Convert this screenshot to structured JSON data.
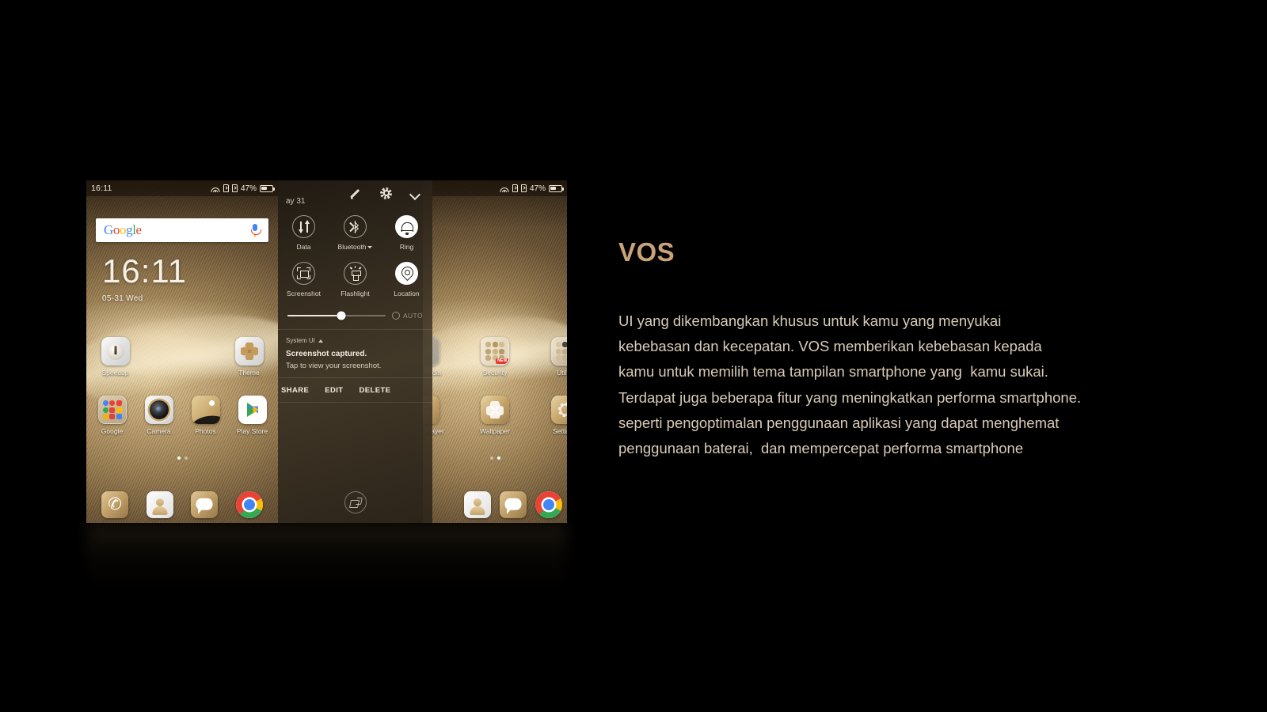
{
  "marketing": {
    "headline": "VOS",
    "body": "UI yang dikembangkan khusus untuk kamu yang menyukai\nkebebasan dan kecepatan. VOS memberikan kebebasan kepada\nkamu untuk memilih tema tampilan smartphone yang  kamu sukai.\nTerdapat juga beberapa fitur yang meningkatkan performa smartphone.\nseperti pengoptimalan penggunaan aplikasi yang dapat menghemat\npenggunaan baterai,  dan mempercepat performa smartphone",
    "headline_color": "#C9A27A",
    "body_color": "#D9CBB8",
    "background_color": "#000000"
  },
  "status_bar": {
    "clock": "16:11",
    "battery_percent": "47%",
    "icons": [
      "wifi-icon",
      "sim1-signal-icon",
      "sim2-signal-icon",
      "battery-icon"
    ]
  },
  "home_screen": {
    "search": {
      "logo_letters": [
        "G",
        "o",
        "o",
        "g",
        "l",
        "e"
      ],
      "mic_icon": "microphone-icon"
    },
    "clock_widget": {
      "time": "16:11",
      "date": "05-31 Wed"
    },
    "row1": [
      {
        "label": "Speedup",
        "icon": "speedup-icon"
      },
      {
        "label": "Theme",
        "icon": "theme-icon"
      }
    ],
    "row2": [
      {
        "label": "Google",
        "icon": "google-folder-icon"
      },
      {
        "label": "Camera",
        "icon": "camera-icon"
      },
      {
        "label": "Photos",
        "icon": "photos-icon"
      },
      {
        "label": "Play Store",
        "icon": "play-store-icon"
      }
    ],
    "page_dots": {
      "count": 2,
      "active_index": 0
    },
    "dock": [
      {
        "label": "Phone",
        "icon": "phone-icon"
      },
      {
        "label": "Contacts",
        "icon": "contacts-icon"
      },
      {
        "label": "Messages",
        "icon": "message-icon"
      },
      {
        "label": "Chrome",
        "icon": "chrome-icon"
      }
    ]
  },
  "home_screen_right": {
    "row1": [
      {
        "label": "Multimedia",
        "icon": "multimedia-folder-icon",
        "badge": ""
      },
      {
        "label": "Security",
        "icon": "security-folder-icon",
        "badge": "NEW"
      },
      {
        "label": "Utility",
        "icon": "utility-folder-icon",
        "badge": ""
      }
    ],
    "row2": [
      {
        "label": "Music Player",
        "icon": "music-note-icon"
      },
      {
        "label": "Wallpaper",
        "icon": "wallpaper-icon"
      },
      {
        "label": "Settings",
        "icon": "gear-icon"
      }
    ]
  },
  "quick_settings": {
    "date": "ay 31",
    "header_icons": [
      {
        "name": "edit-pencil-icon"
      },
      {
        "name": "settings-gear-icon"
      },
      {
        "name": "collapse-chevron-down-icon"
      }
    ],
    "tiles": [
      {
        "label": "Data",
        "icon": "data-transfer-icon",
        "active": false,
        "has_caret": false
      },
      {
        "label": "Bluetooth",
        "icon": "bluetooth-icon",
        "active": false,
        "has_caret": true
      },
      {
        "label": "Ring",
        "icon": "bell-icon",
        "active": true,
        "has_caret": false
      },
      {
        "label": "Screenshot",
        "icon": "screenshot-icon",
        "active": false,
        "has_caret": false
      },
      {
        "label": "Flashlight",
        "icon": "flashlight-icon",
        "active": false,
        "has_caret": false
      },
      {
        "label": "Location",
        "icon": "location-pin-icon",
        "active": true,
        "has_caret": false
      }
    ],
    "brightness": {
      "value_percent": 55,
      "auto_label": "AUTO",
      "auto_enabled": false
    },
    "notification": {
      "source": "System UI",
      "title": "Screenshot captured.",
      "subtitle": "Tap to view your screenshot.",
      "actions": [
        "SHARE",
        "EDIT",
        "DELETE"
      ]
    },
    "clear_all_icon": "clear-all-brush-icon"
  }
}
